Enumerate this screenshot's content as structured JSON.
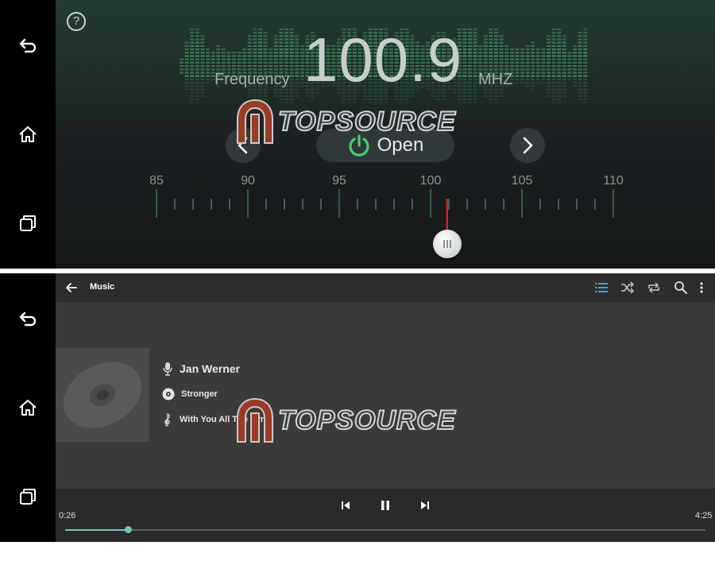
{
  "nav": {
    "icons": [
      "back-arrow-icon",
      "home-icon",
      "recent-apps-icon"
    ]
  },
  "radio": {
    "help_glyph": "?",
    "frequency_label": "Frequency",
    "frequency_value": "100.9",
    "unit": "MHZ",
    "open_label": "Open",
    "scale_labels": [
      "85",
      "90",
      "95",
      "100",
      "105",
      "110"
    ],
    "tuned_frequency": 100.9,
    "scale_range": [
      85,
      110
    ],
    "accent_color": "#3fd46a",
    "needle_color": "#e0232b"
  },
  "watermark": {
    "text": "TOPSOURCE"
  },
  "player": {
    "title": "Music",
    "artist": "Jan Werner",
    "album": "Stronger",
    "song": "With You All The Time",
    "elapsed": "0:26",
    "duration": "4:25",
    "progress": 0.098,
    "accent_color": "#6cc9bf",
    "toolbar_active_color": "#3aa7d8"
  }
}
